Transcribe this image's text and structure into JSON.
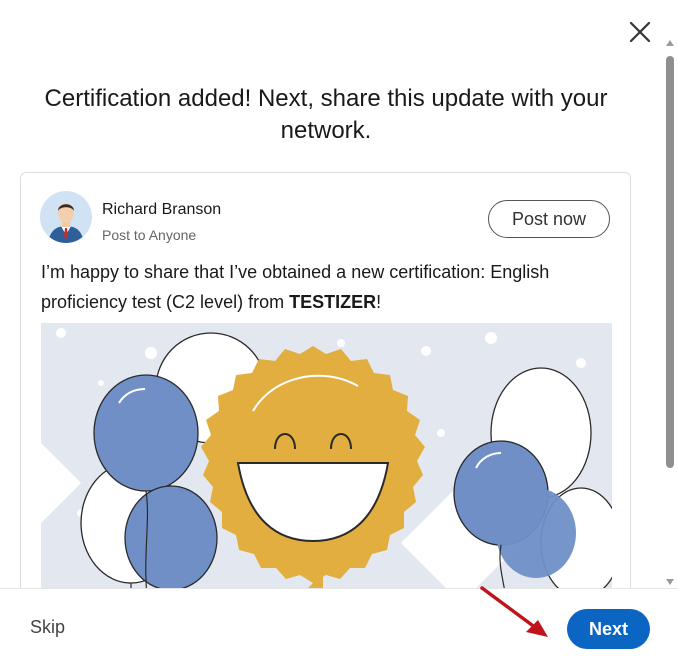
{
  "modal": {
    "title": "Certification added! Next, share this update with your network.",
    "close_icon": "close-icon"
  },
  "post": {
    "author": "Richard Branson",
    "visibility": "Post to Anyone",
    "post_now_label": "Post now",
    "text_before": "I’m happy to share that I’ve obtained a new certification: English proficiency test (C2 level) from ",
    "text_brand": "TESTIZER",
    "text_after": "!"
  },
  "footer": {
    "skip_label": "Skip",
    "next_label": "Next"
  },
  "colors": {
    "accent": "#0a66c2",
    "annotation_arrow": "#c0141c",
    "balloon_blue": "#6f8fc6",
    "badge_gold": "#e2ae3f"
  }
}
